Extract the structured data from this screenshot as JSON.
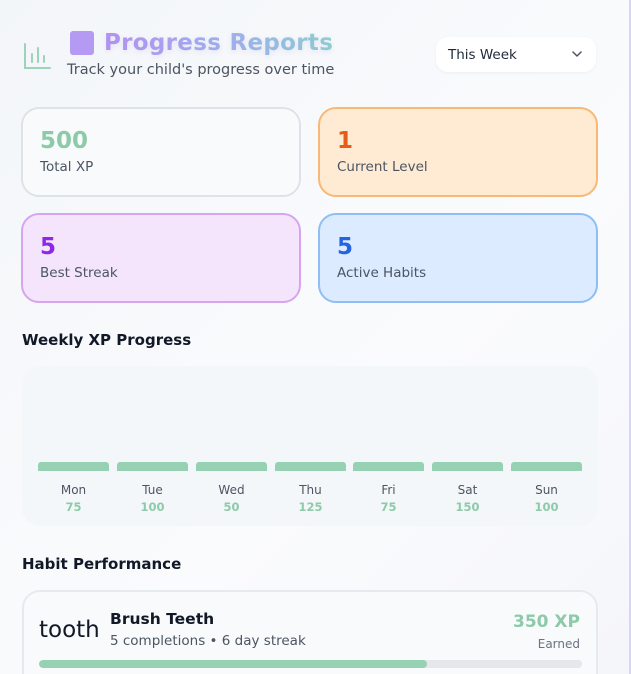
{
  "header": {
    "title": "Progress Reports",
    "subtitle": "Track your child's progress over time",
    "period_select": {
      "value": "This Week"
    }
  },
  "stats": [
    {
      "value": "500",
      "label": "Total XP"
    },
    {
      "value": "1",
      "label": "Current Level"
    },
    {
      "value": "5",
      "label": "Best Streak"
    },
    {
      "value": "5",
      "label": "Active Habits"
    }
  ],
  "weekly": {
    "title": "Weekly XP Progress",
    "days": [
      {
        "day": "Mon",
        "xp": "75"
      },
      {
        "day": "Tue",
        "xp": "100"
      },
      {
        "day": "Wed",
        "xp": "50"
      },
      {
        "day": "Thu",
        "xp": "125"
      },
      {
        "day": "Fri",
        "xp": "75"
      },
      {
        "day": "Sat",
        "xp": "150"
      },
      {
        "day": "Sun",
        "xp": "100"
      }
    ]
  },
  "habits": {
    "title": "Habit Performance",
    "items": [
      {
        "icon": "tooth",
        "name": "Brush Teeth",
        "meta": "5 completions • 6 day streak",
        "xp": "350 XP",
        "earned_label": "Earned",
        "progress": 0.715
      }
    ]
  },
  "colors": {
    "accent_green": "#8ccaa9",
    "title_purple": "#b693f5",
    "level_orange": "#e65c17",
    "streak_purple": "#8c28e6",
    "habits_blue": "#2464df"
  }
}
